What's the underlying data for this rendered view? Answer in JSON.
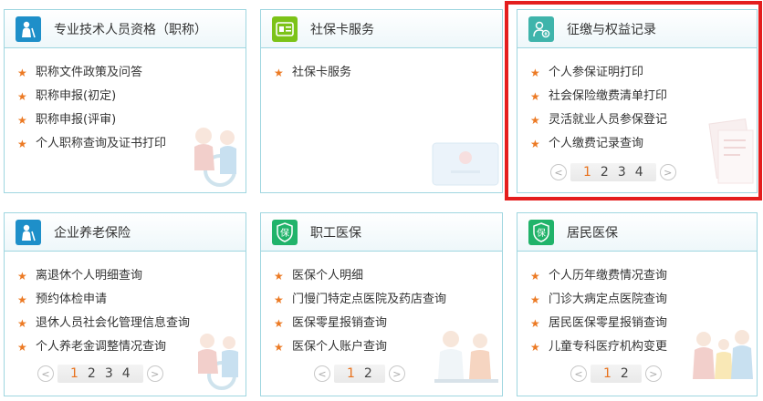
{
  "cards": [
    {
      "title": "专业技术人员资格（职称）",
      "icon": "elder-person-icon",
      "icon_color": "#1e8fc9",
      "items": [
        "职称文件政策及问答",
        "职称申报(初定)",
        "职称申报(评审)",
        "个人职称查询及证书打印"
      ],
      "pages": []
    },
    {
      "title": "社保卡服务",
      "icon": "id-card-icon",
      "icon_color": "#7cc318",
      "items": [
        "社保卡服务"
      ],
      "pages": []
    },
    {
      "title": "征缴与权益记录",
      "icon": "person-coin-icon",
      "icon_color": "#3fb4ab",
      "items": [
        "个人参保证明打印",
        "社会保险缴费清单打印",
        "灵活就业人员参保登记",
        "个人缴费记录查询"
      ],
      "pages": [
        "1",
        "2",
        "3",
        "4"
      ]
    },
    {
      "title": "企业养老保险",
      "icon": "elder-person-icon",
      "icon_color": "#1e8fc9",
      "items": [
        "离退休个人明细查询",
        "预约体检申请",
        "退休人员社会化管理信息查询",
        "个人养老金调整情况查询"
      ],
      "pages": [
        "1",
        "2",
        "3",
        "4"
      ]
    },
    {
      "title": "职工医保",
      "icon": "shield-bao-icon",
      "icon_color": "#21b36a",
      "items": [
        "医保个人明细",
        "门慢门特定点医院及药店查询",
        "医保零星报销查询",
        "医保个人账户查询"
      ],
      "pages": [
        "1",
        "2"
      ]
    },
    {
      "title": "居民医保",
      "icon": "shield-bao-icon",
      "icon_color": "#21b36a",
      "items": [
        "个人历年缴费情况查询",
        "门诊大病定点医院查询",
        "居民医保零星报销查询",
        "儿童专科医疗机构变更"
      ],
      "pages": [
        "1",
        "2"
      ]
    }
  ],
  "pager": {
    "prev": "<",
    "next": ">"
  },
  "shield_char": "保",
  "highlight_color": "#e41e1e"
}
